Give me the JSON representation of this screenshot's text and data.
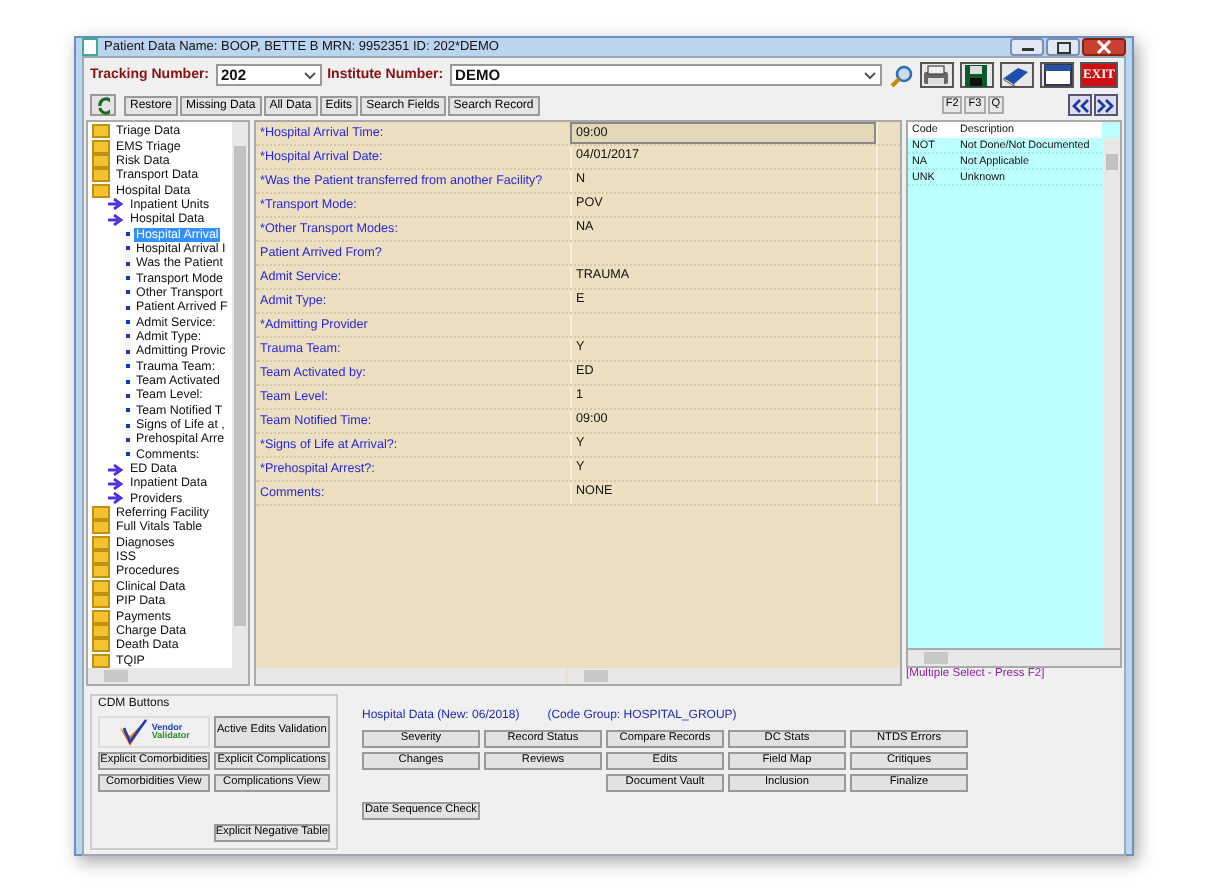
{
  "window": {
    "title": "Patient Data Name: BOOP, BETTE B MRN: 9952351 ID: 202*DEMO"
  },
  "tracking": {
    "label": "Tracking Number:",
    "value": "202"
  },
  "institute": {
    "label": "Institute Number:",
    "value": "DEMO"
  },
  "exit_label": "EXIT",
  "toolbar_buttons": [
    "Restore",
    "Missing Data",
    "All Data",
    "Edits",
    "Search Fields",
    "Search Record"
  ],
  "function_keys": [
    "F2",
    "F3",
    "Q"
  ],
  "tree": [
    {
      "label": "Triage Data",
      "kind": "folder"
    },
    {
      "label": "EMS Triage",
      "kind": "folder"
    },
    {
      "label": "Risk Data",
      "kind": "folder"
    },
    {
      "label": "Transport Data",
      "kind": "folder"
    },
    {
      "label": "Hospital Data",
      "kind": "folder",
      "children": [
        {
          "label": "Inpatient Units",
          "kind": "group"
        },
        {
          "label": "Hospital Data",
          "kind": "group",
          "children": [
            {
              "label": "Hospital Arrival",
              "kind": "field",
              "selected": true
            },
            {
              "label": "Hospital Arrival I",
              "kind": "field",
              "selected": false
            },
            {
              "label": "Was the Patient",
              "kind": "field",
              "selected": false
            },
            {
              "label": "Transport Mode",
              "kind": "field",
              "selected": false
            },
            {
              "label": "Other Transport",
              "kind": "field",
              "selected": false
            },
            {
              "label": "Patient Arrived F",
              "kind": "field",
              "selected": false
            },
            {
              "label": "Admit Service:",
              "kind": "field",
              "selected": false
            },
            {
              "label": "Admit Type:",
              "kind": "field",
              "selected": false
            },
            {
              "label": "Admitting Provic",
              "kind": "field",
              "selected": false
            },
            {
              "label": "Trauma Team:",
              "kind": "field",
              "selected": false
            },
            {
              "label": "Team Activated",
              "kind": "field",
              "selected": false
            },
            {
              "label": "Team Level:",
              "kind": "field",
              "selected": false
            },
            {
              "label": "Team Notified T",
              "kind": "field",
              "selected": false
            },
            {
              "label": "Signs of Life at ,",
              "kind": "field",
              "selected": false
            },
            {
              "label": "Prehospital Arre",
              "kind": "field",
              "selected": false
            },
            {
              "label": "Comments:",
              "kind": "field",
              "selected": false
            }
          ]
        },
        {
          "label": "ED Data",
          "kind": "group"
        },
        {
          "label": "Inpatient Data",
          "kind": "group"
        },
        {
          "label": "Providers",
          "kind": "group"
        }
      ]
    },
    {
      "label": "Referring Facility",
      "kind": "folder"
    },
    {
      "label": "Full Vitals Table",
      "kind": "folder"
    },
    {
      "label": "Diagnoses",
      "kind": "folder"
    },
    {
      "label": "ISS",
      "kind": "folder"
    },
    {
      "label": "Procedures",
      "kind": "folder"
    },
    {
      "label": "Clinical Data",
      "kind": "folder"
    },
    {
      "label": "PIP Data",
      "kind": "folder"
    },
    {
      "label": "Payments",
      "kind": "folder"
    },
    {
      "label": "Charge Data",
      "kind": "folder"
    },
    {
      "label": "Death Data",
      "kind": "folder"
    },
    {
      "label": "TQIP",
      "kind": "folder"
    }
  ],
  "fields": [
    {
      "label": "*Hospital Arrival Time:",
      "value": "09:00",
      "selected": true
    },
    {
      "label": "*Hospital Arrival Date:",
      "value": "04/01/2017",
      "selected": false
    },
    {
      "label": "*Was the Patient transferred from another Facility?",
      "value": "N",
      "selected": false
    },
    {
      "label": "*Transport Mode:",
      "value": "POV",
      "selected": false
    },
    {
      "label": "*Other Transport Modes:",
      "value": "NA",
      "selected": false
    },
    {
      "label": "Patient Arrived From?",
      "selected": false
    },
    {
      "label": "Admit Service:",
      "value": "TRAUMA",
      "selected": false
    },
    {
      "label": "Admit Type:",
      "value": "E",
      "selected": false
    },
    {
      "label": "*Admitting Provider",
      "selected": false
    },
    {
      "label": "Trauma Team:",
      "value": "Y",
      "selected": false
    },
    {
      "label": "Team Activated by:",
      "value": "ED",
      "selected": false
    },
    {
      "label": "Team Level:",
      "value": "1",
      "selected": false
    },
    {
      "label": "Team Notified Time:",
      "value": "09:00",
      "selected": false
    },
    {
      "label": "*Signs of Life at Arrival?:",
      "value": "Y",
      "selected": false
    },
    {
      "label": "*Prehospital Arrest?:",
      "value": "Y",
      "selected": false
    },
    {
      "label": "Comments:",
      "value": "NONE",
      "selected": false
    }
  ],
  "codes": {
    "columns": [
      "Code",
      "Description"
    ],
    "rows": [
      [
        "NOT",
        "Not Done/Not Documented"
      ],
      [
        "NA",
        "Not Applicable"
      ],
      [
        "UNK",
        "Unknown"
      ]
    ],
    "hint": "[Multiple Select - Press F2]"
  },
  "cdm": {
    "title": "CDM Buttons",
    "logo": [
      "Vendor",
      "Validator"
    ],
    "buttons": [
      "Active Edits Validation",
      "Explicit Comorbidities",
      "Explicit Complications",
      "Comorbidities View",
      "Complications View",
      "Explicit Negative Table"
    ]
  },
  "section": {
    "title": "Hospital Data (New: 06/2018)",
    "code_group": "(Code Group: HOSPITAL_GROUP)"
  },
  "action_rows": [
    [
      "Severity",
      "Record Status",
      "Compare Records",
      "DC Stats",
      "NTDS Errors"
    ],
    [
      "Changes",
      "Reviews",
      "Edits",
      "Field Map",
      "Critiques"
    ],
    [
      "Document Vault",
      "Inclusion",
      "Finalize"
    ]
  ],
  "extra_button": "Date Sequence Check"
}
